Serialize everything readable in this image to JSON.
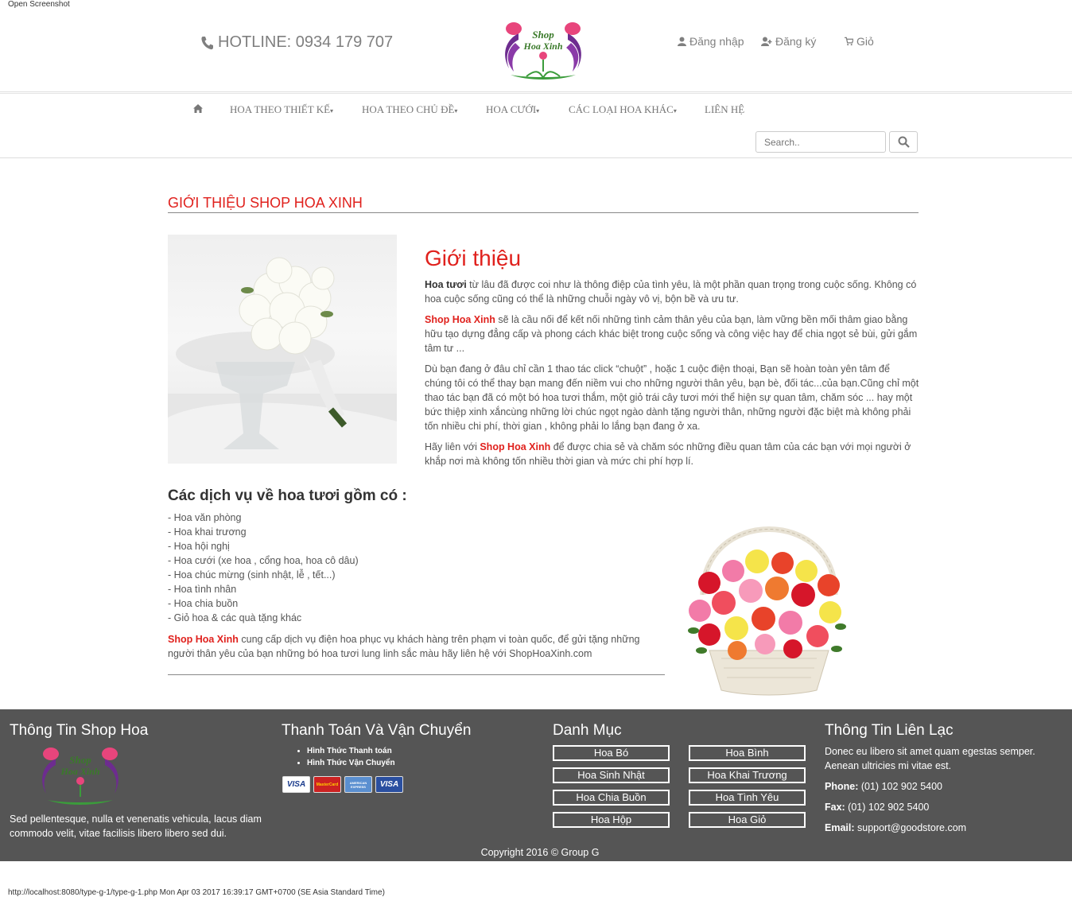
{
  "top_note": "Open Screenshot",
  "bottom_note": "http://localhost:8080/type-g-1/type-g-1.php Mon Apr 03 2017 16:39:17 GMT+0700 (SE Asia Standard Time)",
  "header": {
    "hotline": "HOTLINE: 0934 179 707",
    "logo_text_top": "Shop",
    "logo_text_bottom": "Hoa Xinh",
    "login": "Đăng nhập",
    "register": "Đăng ký",
    "cart": "Giỏ"
  },
  "nav": {
    "items": [
      {
        "label": "HOA THEO THIẾT KẾ"
      },
      {
        "label": "HOA THEO CHỦ ĐỀ"
      },
      {
        "label": "HOA CƯỚI"
      },
      {
        "label": "CÁC LOẠI HOA KHÁC"
      },
      {
        "label": "LIÊN HỆ"
      }
    ],
    "search_placeholder": "Search.."
  },
  "main": {
    "section_title": "GIỚI THIỆU SHOP HOA XINH",
    "intro_heading": "Giới thiệu",
    "p1_bold": "Hoa tươi",
    "p1_text": " từ lâu đã được coi như là thông điệp của tình yêu, là một phần quan trọng trong cuộc sống. Không có hoa cuộc sống cũng có thể là những chuỗi ngày vô vị, bộn bề và ưu tư.",
    "p2_brand": "Shop Hoa Xinh",
    "p2_text": " sẽ là cầu nối để kết nối những tình cảm thân yêu của bạn, làm vững bền mối thâm giao bằng hữu tạo dựng đẳng cấp và phong cách khác biệt trong cuộc sống và công việc hay để chia ngọt sẻ bùi, gửi gắm tâm tư ...",
    "p3_text": "Dù bạn đang ở đâu chỉ cần 1 thao tác click “chuột” , hoặc 1 cuộc điện thoại, Bạn sẽ hoàn toàn yên tâm để chúng tôi có thể thay bạn mang đến niềm vui cho những người thân yêu, bạn bè, đối tác...của bạn.Cũng chỉ một thao tác bạn đã có một bó hoa tươi thắm, một giỏ trái cây tươi mới thể hiện sự quan tâm, chăm sóc ... hay một bức thiệp xinh xắncùng những lời chúc ngọt ngào dành tặng người thân, những người đặc biệt mà không phải tốn nhiều chi phí, thời gian , không phải lo lắng bạn đang ở xa.",
    "p4_prefix": "Hãy liên với ",
    "p4_brand": "Shop Hoa Xinh",
    "p4_text": " để được chia sẻ và chăm sóc những điều quan tâm của các bạn với mọi người ở khắp nơi mà không tốn nhiều thời gian và mức chi phí hợp lí.",
    "services_title": "Các dịch vụ về hoa tươi gồm có :",
    "services": [
      "- Hoa văn phòng",
      "- Hoa khai trương",
      "- Hoa hội nghị",
      "- Hoa cưới (xe hoa , cổng hoa, hoa cô dâu)",
      "- Hoa chúc mừng (sinh nhật, lễ , tết...)",
      "- Hoa tình nhân",
      "- Hoa chia buồn",
      "- Giỏ hoa & các quà tặng khác"
    ],
    "services_foot_brand": "Shop Hoa Xinh",
    "services_foot_text": " cung cấp dịch vụ điện hoa phục vụ khách hàng trên phạm vi toàn quốc, để gửi tặng những người thân yêu của bạn những bó hoa tươi lung linh sắc màu hãy liên hệ với ShopHoaXinh.com"
  },
  "footer": {
    "col1_title": "Thông Tin Shop Hoa",
    "col1_desc": "Sed pellentesque, nulla et venenatis vehicula, lacus diam commodo velit, vitae facilisis libero libero sed dui.",
    "col2_title": "Thanh Toán Và Vận Chuyển",
    "col2_links": [
      "Hình Thức Thanh toán",
      "Hình Thức Vận Chuyển"
    ],
    "cards": [
      "VISA",
      "MasterCard",
      "AMERICAN EXPRESS",
      "VISA"
    ],
    "col3_title": "Danh Mục",
    "categories": [
      "Hoa Bó",
      "Hoa Bình",
      "Hoa Sinh Nhật",
      "Hoa Khai Trương",
      "Hoa Chia Buồn",
      "Hoa Tình Yêu",
      "Hoa Hộp",
      "Hoa Giỏ"
    ],
    "col4_title": "Thông Tin Liên Lạc",
    "contact_desc": "Donec eu libero sit amet quam egestas semper. Aenean ultricies mi vitae est.",
    "phone_label": "Phone:",
    "phone_value": " (01) 102 902 5400",
    "fax_label": "Fax:",
    "fax_value": " (01) 102 902 5400",
    "email_label": "Email:",
    "email_value": " support@goodstore.com",
    "copyright": "Copyright 2016 © Group G"
  },
  "colors": {
    "accent_red": "#e0211d",
    "footer_bg": "#555555",
    "nav_text": "#777777"
  }
}
